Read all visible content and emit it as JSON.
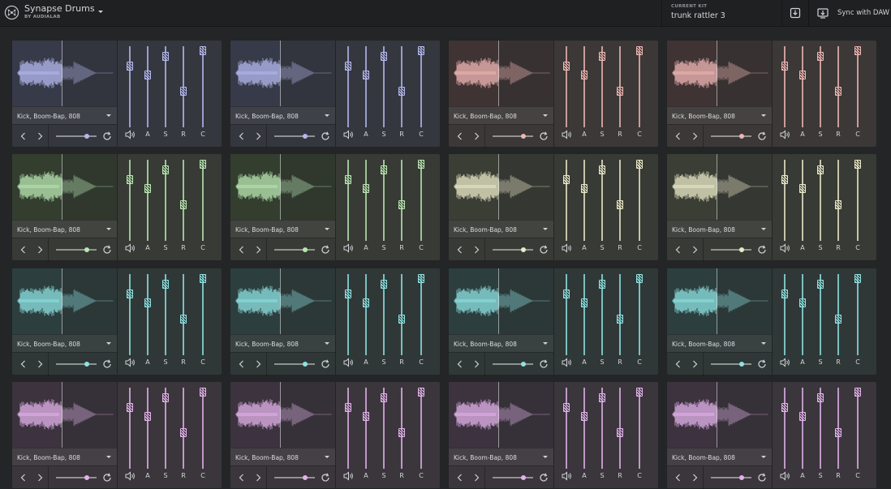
{
  "app": {
    "title": "Synapse Drums",
    "subtitle": "BY AUDIALAB",
    "icon": "synapse-logo-icon"
  },
  "kit": {
    "label": "CURRENT KIT",
    "name": "trunk rattler 3"
  },
  "toolbar": {
    "export_icon": "export-icon",
    "sync_icon": "sync-daw-icon",
    "sync_label": "Sync with DAW"
  },
  "fader_labels": [
    "A",
    "S",
    "R",
    "C"
  ],
  "themes": {
    "lavender": {
      "accent": "#b4b8ee",
      "bg": "#35373f",
      "wave_bg": "#3f4252"
    },
    "pink": {
      "accent": "#eeb6b4",
      "bg": "#3b3837",
      "wave_bg": "#483b3c"
    },
    "green": {
      "accent": "#b9e6b2",
      "bg": "#373a35",
      "wave_bg": "#3b4736"
    },
    "cream": {
      "accent": "#eae9c8",
      "bg": "#383a35",
      "wave_bg": "#44473d"
    },
    "cyan": {
      "accent": "#8ee2e2",
      "bg": "#303837",
      "wave_bg": "#344747"
    },
    "purple": {
      "accent": "#e2b2ea",
      "bg": "#3a363c",
      "wave_bg": "#453b48"
    }
  },
  "pads": [
    {
      "name": "Kick, Boom-Bap, 808",
      "theme": "lavender",
      "tune": 0.75,
      "faders": [
        0.77,
        0.63,
        0.91,
        0.39,
        1.0
      ]
    },
    {
      "name": "Kick, Boom-Bap, 808",
      "theme": "lavender",
      "tune": 0.75,
      "faders": [
        0.77,
        0.63,
        0.91,
        0.39,
        1.0
      ]
    },
    {
      "name": "Kick, Boom-Bap, 808",
      "theme": "pink",
      "tune": 0.75,
      "faders": [
        0.77,
        0.63,
        0.91,
        0.39,
        1.0
      ]
    },
    {
      "name": "Kick, Boom-Bap, 808",
      "theme": "pink",
      "tune": 0.75,
      "faders": [
        0.77,
        0.63,
        0.91,
        0.39,
        1.0
      ]
    },
    {
      "name": "Kick, Boom-Bap, 808",
      "theme": "green",
      "tune": 0.75,
      "faders": [
        0.77,
        0.63,
        0.91,
        0.39,
        1.0
      ]
    },
    {
      "name": "Kick, Boom-Bap, 808",
      "theme": "green",
      "tune": 0.75,
      "faders": [
        0.77,
        0.63,
        0.91,
        0.39,
        1.0
      ]
    },
    {
      "name": "Kick, Boom-Bap, 808",
      "theme": "cream",
      "tune": 0.75,
      "faders": [
        0.77,
        0.63,
        0.91,
        0.39,
        1.0
      ]
    },
    {
      "name": "Kick, Boom-Bap, 808",
      "theme": "cream",
      "tune": 0.75,
      "faders": [
        0.77,
        0.63,
        0.91,
        0.39,
        1.0
      ]
    },
    {
      "name": "Kick, Boom-Bap, 808",
      "theme": "cyan",
      "tune": 0.75,
      "faders": [
        0.77,
        0.63,
        0.91,
        0.39,
        1.0
      ]
    },
    {
      "name": "Kick, Boom-Bap, 808",
      "theme": "cyan",
      "tune": 0.75,
      "faders": [
        0.77,
        0.63,
        0.91,
        0.39,
        1.0
      ]
    },
    {
      "name": "Kick, Boom-Bap, 808",
      "theme": "cyan",
      "tune": 0.75,
      "faders": [
        0.77,
        0.63,
        0.91,
        0.39,
        1.0
      ]
    },
    {
      "name": "Kick, Boom-Bap, 808",
      "theme": "cyan",
      "tune": 0.75,
      "faders": [
        0.77,
        0.63,
        0.91,
        0.39,
        1.0
      ]
    },
    {
      "name": "Kick, Boom-Bap, 808",
      "theme": "purple",
      "tune": 0.75,
      "faders": [
        0.77,
        0.63,
        0.91,
        0.39,
        1.0
      ]
    },
    {
      "name": "Kick, Boom-Bap, 808",
      "theme": "purple",
      "tune": 0.75,
      "faders": [
        0.77,
        0.63,
        0.91,
        0.39,
        1.0
      ]
    },
    {
      "name": "Kick, Boom-Bap, 808",
      "theme": "purple",
      "tune": 0.75,
      "faders": [
        0.77,
        0.63,
        0.91,
        0.39,
        1.0
      ]
    },
    {
      "name": "Kick, Boom-Bap, 808",
      "theme": "purple",
      "tune": 0.75,
      "faders": [
        0.77,
        0.63,
        0.91,
        0.39,
        1.0
      ]
    }
  ]
}
